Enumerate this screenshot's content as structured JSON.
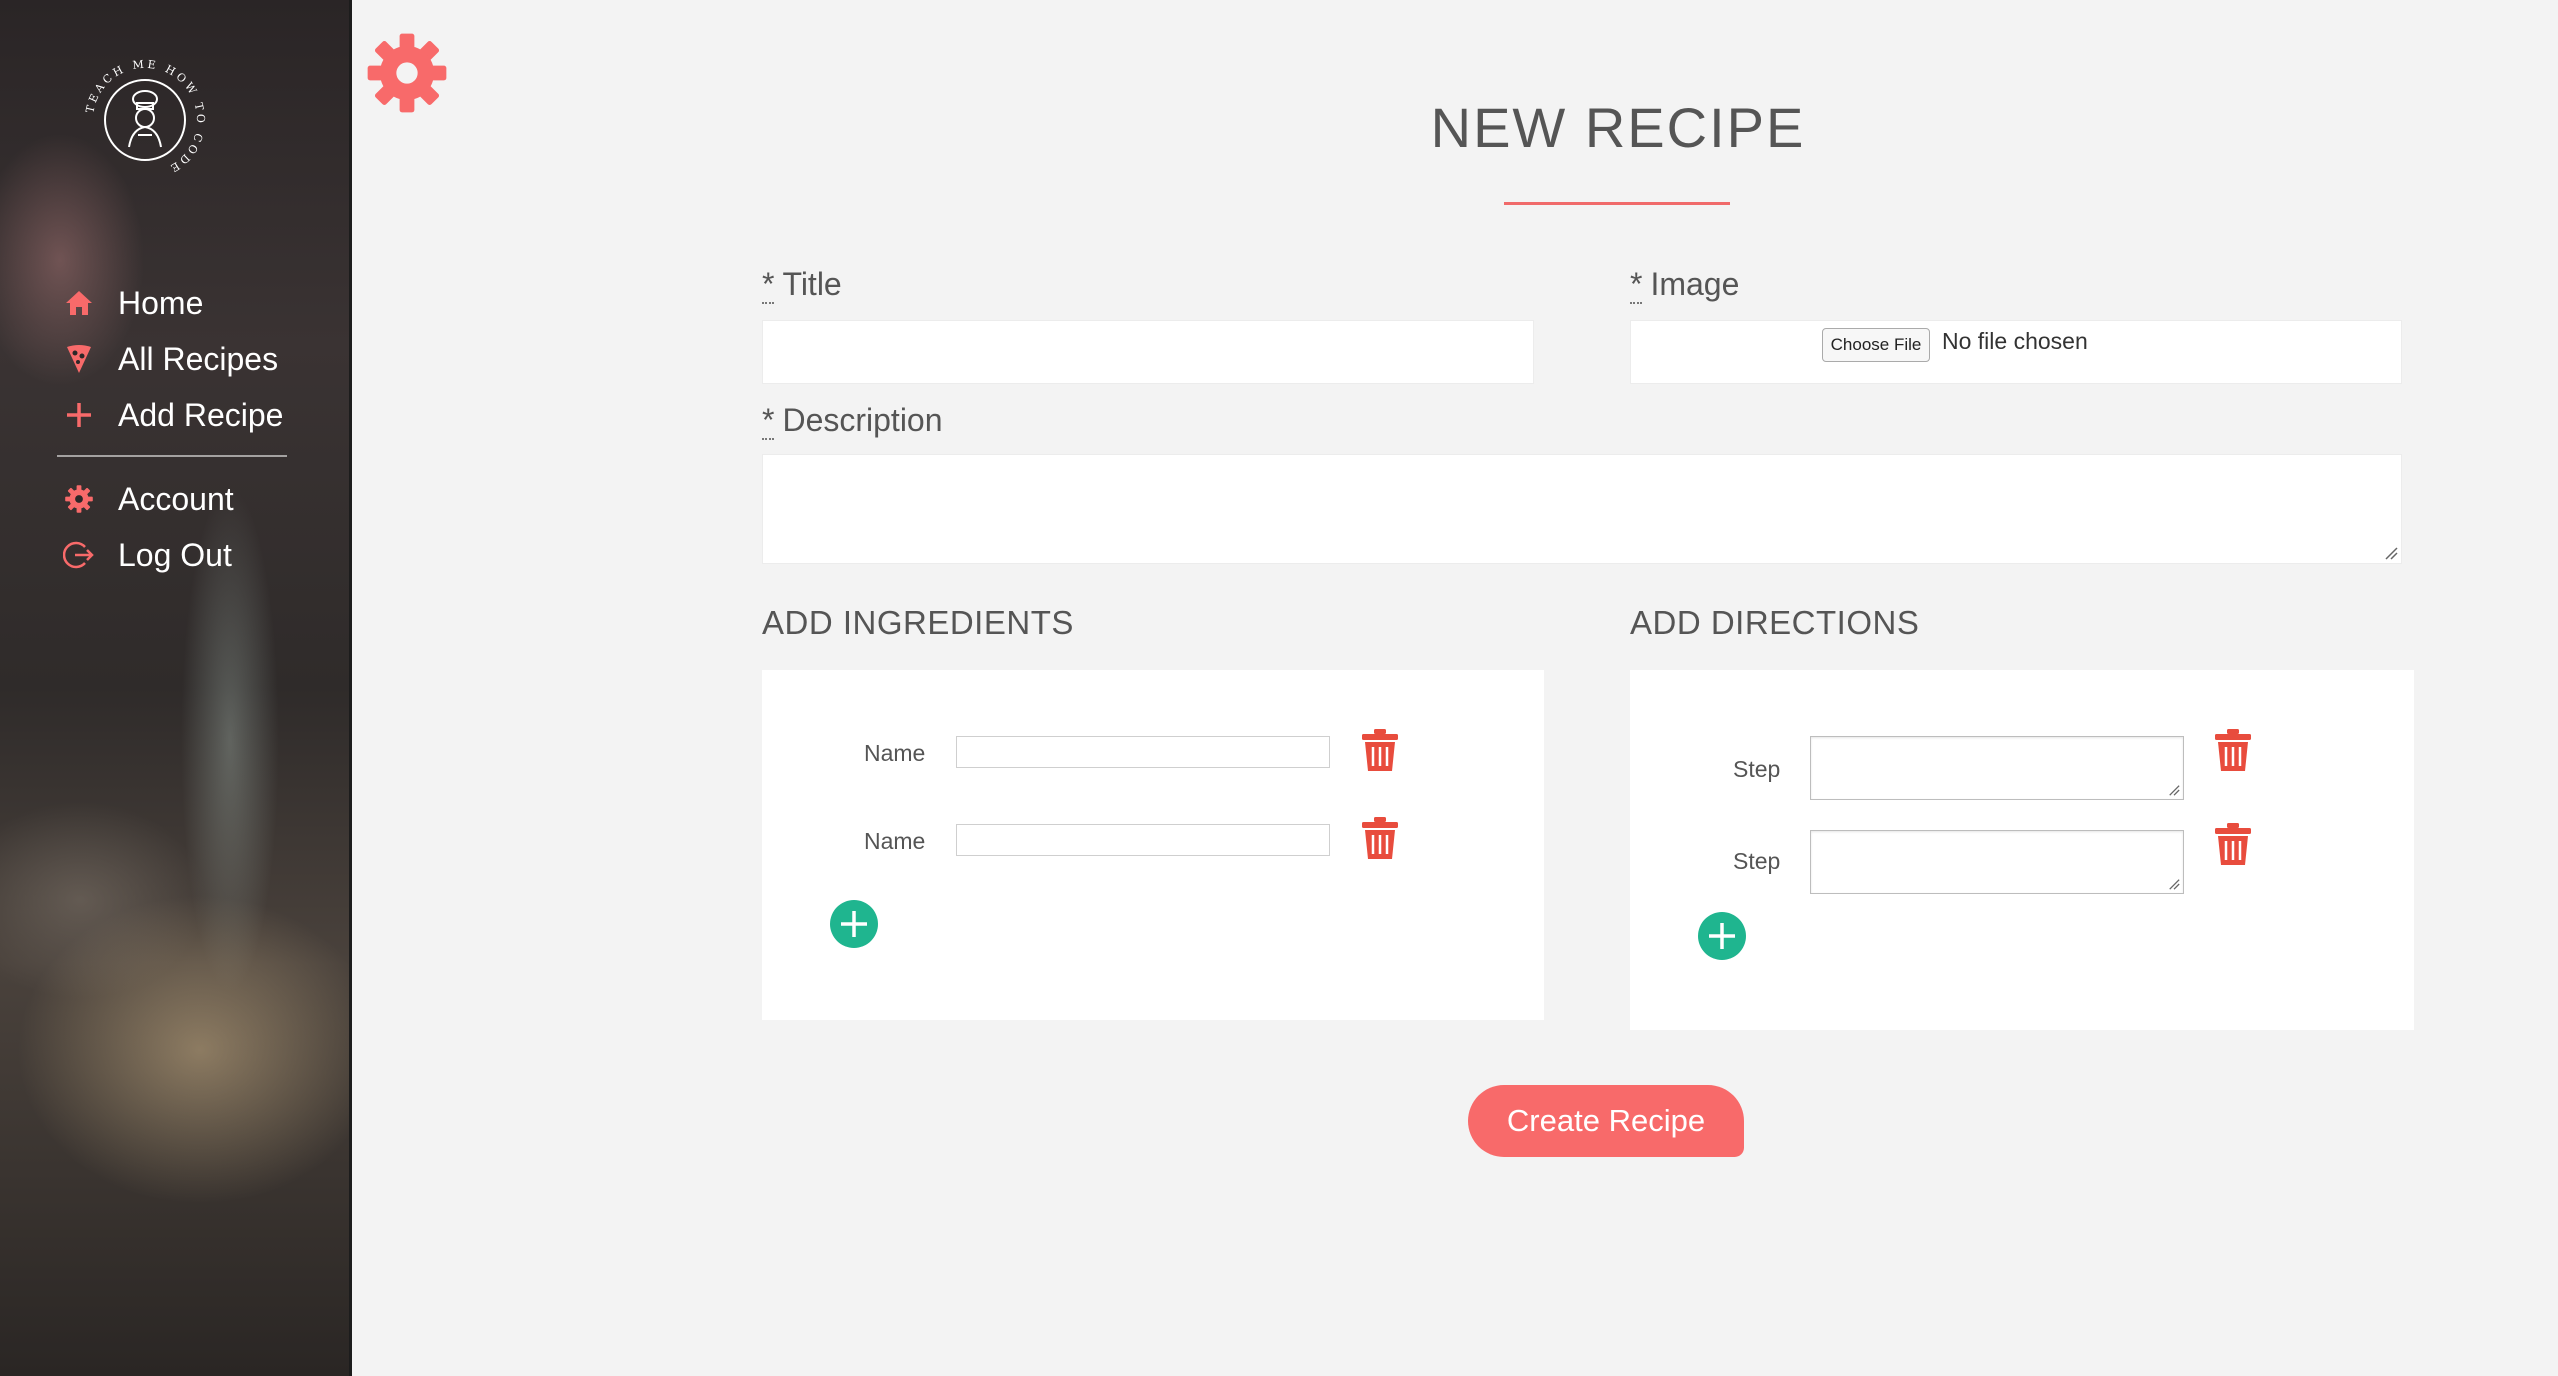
{
  "sidebar": {
    "logo_text": "TEACH ME HOW TO CODE",
    "items": [
      {
        "label": "Home",
        "icon": "home-icon"
      },
      {
        "label": "All Recipes",
        "icon": "pizza-icon"
      },
      {
        "label": "Add Recipe",
        "icon": "plus-icon"
      },
      {
        "label": "Account",
        "icon": "gear-icon"
      },
      {
        "label": "Log Out",
        "icon": "logout-icon"
      }
    ]
  },
  "header": {
    "title": "NEW RECIPE",
    "settings_icon": "gear-icon"
  },
  "form": {
    "required_mark": "*",
    "title_label": "Title",
    "title_value": "",
    "image_label": "Image",
    "choose_file_label": "Choose File",
    "file_status": "No file chosen",
    "description_label": "Description",
    "description_value": ""
  },
  "ingredients": {
    "heading": "ADD INGREDIENTS",
    "rows": [
      {
        "label": "Name",
        "value": ""
      },
      {
        "label": "Name",
        "value": ""
      }
    ]
  },
  "directions": {
    "heading": "ADD DIRECTIONS",
    "rows": [
      {
        "label": "Step",
        "value": ""
      },
      {
        "label": "Step",
        "value": ""
      }
    ]
  },
  "actions": {
    "create_label": "Create Recipe"
  },
  "colors": {
    "accent": "#f86a6a",
    "add_button": "#1fb58f",
    "trash": "#e84c3d",
    "background": "#f3f3f3"
  }
}
